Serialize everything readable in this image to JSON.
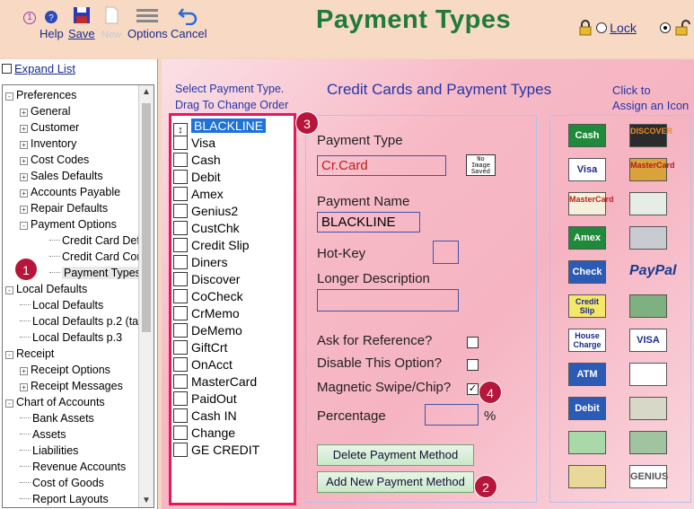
{
  "toolbar": {
    "help_label": "Help",
    "save_label": "Save",
    "new_label": "New",
    "options_label": "Options",
    "cancel_label": "Cancel",
    "lock_label": "Lock"
  },
  "page_title": "Payment Types",
  "sidebar": {
    "expand_label": "Expand List",
    "tree": [
      {
        "label": "Preferences",
        "level": 0,
        "sign": "-"
      },
      {
        "label": "General",
        "level": 1,
        "sign": "+"
      },
      {
        "label": "Customer",
        "level": 1,
        "sign": "+"
      },
      {
        "label": "Inventory",
        "level": 1,
        "sign": "+"
      },
      {
        "label": "Cost Codes",
        "level": 1,
        "sign": "+"
      },
      {
        "label": "Sales Defaults",
        "level": 1,
        "sign": "+"
      },
      {
        "label": "Accounts Payable",
        "level": 1,
        "sign": "+"
      },
      {
        "label": "Repair Defaults",
        "level": 1,
        "sign": "+"
      },
      {
        "label": "Payment Options",
        "level": 1,
        "sign": "-"
      },
      {
        "label": "Credit Card Defau",
        "level": 2,
        "sign": ""
      },
      {
        "label": "Credit Card Cont.",
        "level": 2,
        "sign": ""
      },
      {
        "label": "Payment Types",
        "level": 2,
        "sign": ""
      },
      {
        "label": "Local Defaults",
        "level": 0,
        "sign": "-"
      },
      {
        "label": "Local Defaults",
        "level": 1,
        "sign": ""
      },
      {
        "label": "Local Defaults p.2 (ta",
        "level": 1,
        "sign": ""
      },
      {
        "label": "Local Defaults p.3",
        "level": 1,
        "sign": ""
      },
      {
        "label": "Receipt",
        "level": 0,
        "sign": "-"
      },
      {
        "label": "Receipt Options",
        "level": 1,
        "sign": "+"
      },
      {
        "label": "Receipt Messages",
        "level": 1,
        "sign": "+"
      },
      {
        "label": "Chart of Accounts",
        "level": 0,
        "sign": "-"
      },
      {
        "label": "Bank Assets",
        "level": 1,
        "sign": ""
      },
      {
        "label": "Assets",
        "level": 1,
        "sign": ""
      },
      {
        "label": "Liabilities",
        "level": 1,
        "sign": ""
      },
      {
        "label": "Revenue Accounts",
        "level": 1,
        "sign": ""
      },
      {
        "label": "Cost of Goods",
        "level": 1,
        "sign": ""
      },
      {
        "label": "Report Layouts",
        "level": 1,
        "sign": ""
      }
    ]
  },
  "list_header": {
    "line1": "Select Payment Type.",
    "line2": "Drag To Change Order"
  },
  "section_title": "Credit Cards and Payment Types",
  "icon_header": {
    "line1": "Click to",
    "line2": "Assign an Icon"
  },
  "payment_types": [
    "BLACKLINE",
    "Visa",
    "Cash",
    "Debit",
    "Amex",
    "Genius2",
    "CustChk",
    "Credit Slip",
    "Diners",
    "Discover",
    "CoCheck",
    "CrMemo",
    "DeMemo",
    "GiftCrt",
    "OnAcct",
    "MasterCard",
    "PaidOut",
    "Cash IN",
    "Change",
    "GE CREDIT"
  ],
  "form": {
    "payment_type_label": "Payment Type",
    "payment_type_value": "Cr.Card",
    "no_image_text": "No Image Saved",
    "payment_name_label": "Payment Name",
    "payment_name_value": "BLACKLINE",
    "hotkey_label": "Hot-Key",
    "longer_desc_label": "Longer Description",
    "ask_ref_label": "Ask for Reference?",
    "disable_label": "Disable This Option?",
    "magnetic_label": "Magnetic Swipe/Chip?",
    "magnetic_checked": true,
    "percentage_label": "Percentage",
    "percent_sign": "%",
    "delete_button": "Delete Payment Method",
    "add_button": "Add New Payment Method"
  },
  "badges": [
    "1",
    "1",
    "2",
    "3",
    "4"
  ],
  "icons": [
    {
      "name": "cash-card-icon",
      "text": "Cash",
      "bg": "#1f8a3a",
      "fg": "#fff"
    },
    {
      "name": "discover-card-icon",
      "text": "DISCOVER",
      "bg": "#2b2b2b",
      "fg": "#f08a24"
    },
    {
      "name": "visa-card-icon",
      "text": "Visa",
      "bg": "#ffffff",
      "fg": "#1a2a8c"
    },
    {
      "name": "mastercard-small-icon",
      "text": "MasterCard",
      "bg": "#d9a23a",
      "fg": "#b51a1a"
    },
    {
      "name": "mastercard-icon",
      "text": "MasterCard",
      "bg": "#f5f0dc",
      "fg": "#c0201a"
    },
    {
      "name": "check-image-icon",
      "text": "",
      "bg": "#e6ece6",
      "fg": "#333"
    },
    {
      "name": "amex-icon",
      "text": "Amex",
      "bg": "#1f8a3a",
      "fg": "#fff"
    },
    {
      "name": "amex-card-icon",
      "text": "",
      "bg": "#c8ccd0",
      "fg": "#333"
    },
    {
      "name": "check-icon",
      "text": "Check",
      "bg": "#2b5bb5",
      "fg": "#fff"
    },
    {
      "name": "paypal-icon",
      "text": "PayPal",
      "bg": "transparent",
      "fg": "#1a3a8c"
    },
    {
      "name": "credit-slip-icon",
      "text": "Credit Slip",
      "bg": "#f5e76a",
      "fg": "#1a2a8c"
    },
    {
      "name": "money-icon",
      "text": "",
      "bg": "#7fb07f",
      "fg": "#1a4a1a"
    },
    {
      "name": "house-charge-icon",
      "text": "House Charge",
      "bg": "#ffffff",
      "fg": "#1a2a8c"
    },
    {
      "name": "visa-logo-icon",
      "text": "VISA",
      "bg": "#ffffff",
      "fg": "#1a2a8c"
    },
    {
      "name": "atm-icon",
      "text": "ATM",
      "bg": "#2b5bb5",
      "fg": "#fff"
    },
    {
      "name": "diners-icon",
      "text": "",
      "bg": "#ffffff",
      "fg": "#1a3a8c"
    },
    {
      "name": "debit-icon",
      "text": "Debit",
      "bg": "#2b5bb5",
      "fg": "#fff"
    },
    {
      "name": "banknote-icon",
      "text": "",
      "bg": "#d8d8c8",
      "fg": "#333"
    },
    {
      "name": "gift-cert-icon",
      "text": "",
      "bg": "#a9d8a9",
      "fg": "#1a4a1a"
    },
    {
      "name": "bill-icon",
      "text": "",
      "bg": "#9fc49f",
      "fg": "#1a4a1a"
    },
    {
      "name": "certificate-icon",
      "text": "",
      "bg": "#e8d89a",
      "fg": "#6a4a1a"
    },
    {
      "name": "genius-icon",
      "text": "GENIUS",
      "bg": "#ffffff",
      "fg": "#555"
    }
  ]
}
